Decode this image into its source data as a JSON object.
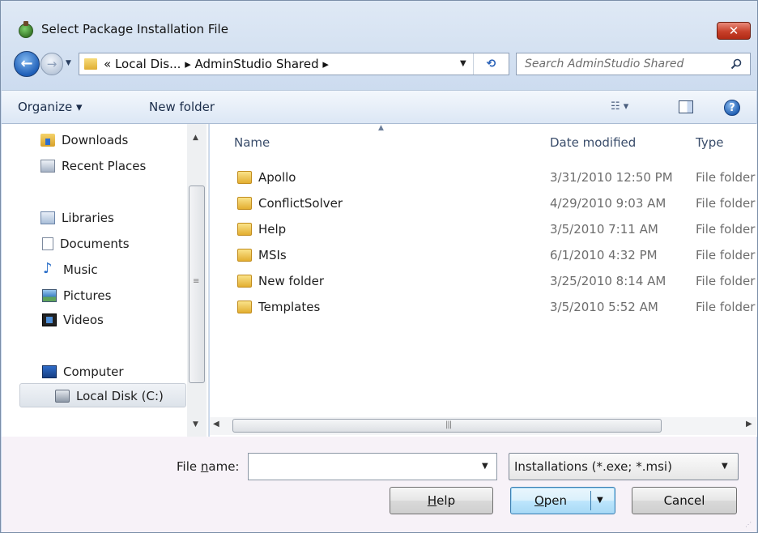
{
  "window": {
    "title": "Select Package Installation File",
    "close_label": "✕"
  },
  "address_bar": {
    "path_text": "« Local Dis...  ▸  AdminStudio Shared  ▸",
    "search_placeholder": "Search AdminStudio Shared"
  },
  "toolbar": {
    "organize_label": "Organize ▾",
    "new_folder_label": "New folder",
    "views_label": "☷ ▾",
    "help_label": "?"
  },
  "nav_pane": {
    "items": [
      {
        "label": "Downloads",
        "icon": "downloads-icon"
      },
      {
        "label": "Recent Places",
        "icon": "recent-places-icon"
      },
      {
        "label": "Libraries",
        "icon": "libraries-icon"
      },
      {
        "label": "Documents",
        "icon": "documents-icon"
      },
      {
        "label": "Music",
        "icon": "music-icon"
      },
      {
        "label": "Pictures",
        "icon": "pictures-icon"
      },
      {
        "label": "Videos",
        "icon": "videos-icon"
      },
      {
        "label": "Computer",
        "icon": "computer-icon"
      },
      {
        "label": "Local Disk (C:)",
        "icon": "local-disk-icon",
        "selected": true
      }
    ]
  },
  "file_list": {
    "columns": [
      "Name",
      "Date modified",
      "Type"
    ],
    "rows": [
      {
        "name": "Apollo",
        "date": "3/31/2010 12:50 PM",
        "type": "File folder"
      },
      {
        "name": "ConflictSolver",
        "date": "4/29/2010 9:03 AM",
        "type": "File folder"
      },
      {
        "name": "Help",
        "date": "3/5/2010 7:11 AM",
        "type": "File folder"
      },
      {
        "name": "MSIs",
        "date": "6/1/2010 4:32 PM",
        "type": "File folder"
      },
      {
        "name": "New folder",
        "date": "3/25/2010 8:14 AM",
        "type": "File folder"
      },
      {
        "name": "Templates",
        "date": "3/5/2010 5:52 AM",
        "type": "File folder"
      }
    ]
  },
  "bottom": {
    "file_name_label_pre": "File ",
    "file_name_label_ul": "n",
    "file_name_label_post": "ame:",
    "file_name_value": "",
    "file_type_selected": "Installations (*.exe; *.msi)",
    "help_ul": "H",
    "help_rest": "elp",
    "open_ul": "O",
    "open_rest": "pen",
    "cancel_label": "Cancel"
  },
  "colors": {
    "accent": "#3c7fb1",
    "close": "#c7402a",
    "folder": "#e3ae30"
  }
}
